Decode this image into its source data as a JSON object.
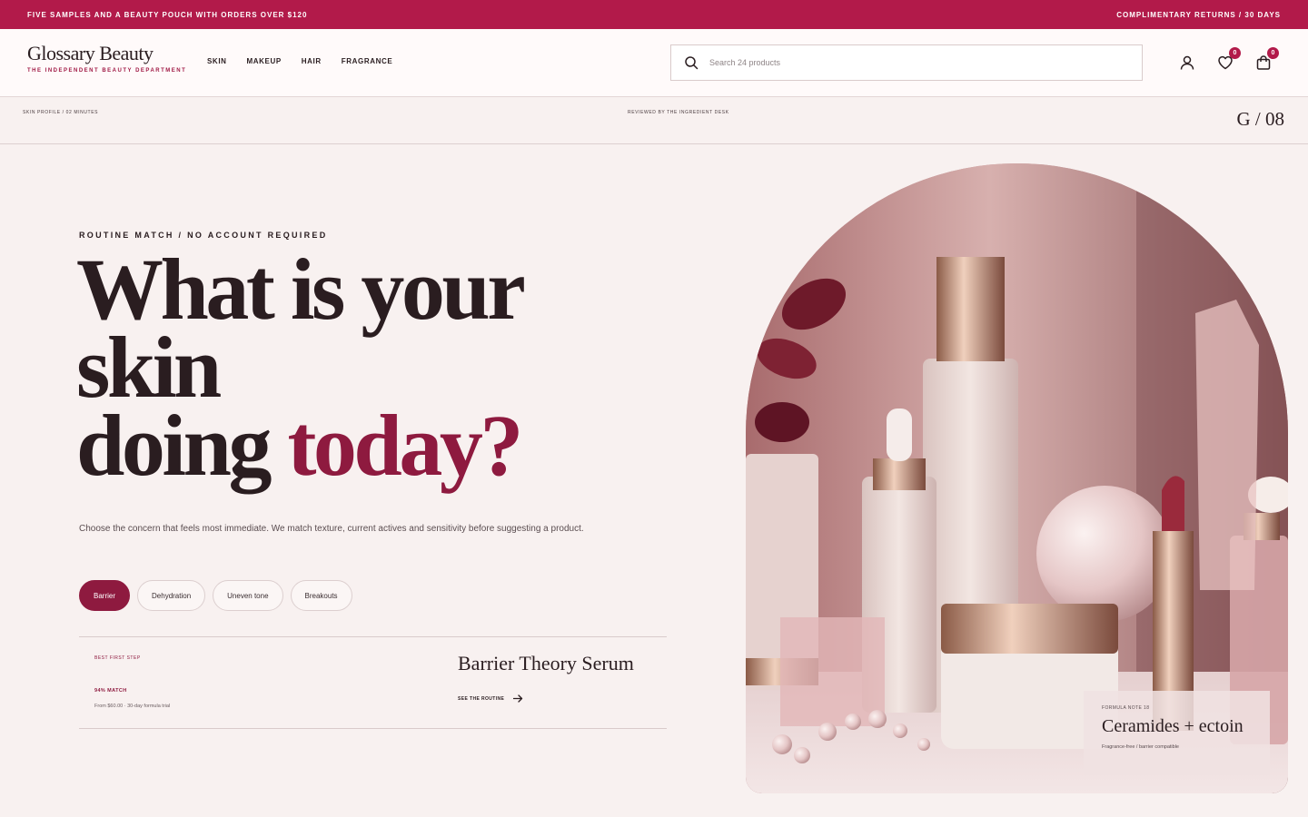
{
  "promo": {
    "left": "FIVE SAMPLES AND A BEAUTY POUCH WITH ORDERS OVER $120",
    "right": "COMPLIMENTARY RETURNS / 30 DAYS"
  },
  "brand": {
    "name": "Glossary Beauty",
    "tagline": "THE INDEPENDENT BEAUTY DEPARTMENT"
  },
  "nav": {
    "items": [
      {
        "label": "SKIN"
      },
      {
        "label": "MAKEUP"
      },
      {
        "label": "HAIR"
      },
      {
        "label": "FRAGRANCE"
      }
    ]
  },
  "search": {
    "placeholder": "Search 24 products",
    "value": ""
  },
  "header_icons": {
    "wishlist_count": "0",
    "bag_count": "0"
  },
  "subbar": {
    "left": "SKIN PROFILE / 02 MINUTES",
    "center": "REVIEWED BY THE INGREDIENT DESK",
    "right": "G / 08"
  },
  "hero": {
    "eyebrow": "ROUTINE MATCH / NO ACCOUNT REQUIRED",
    "headline_line1": "What is your",
    "headline_line2": "skin",
    "headline_line3_a": "doing ",
    "headline_line3_b": "today?",
    "description": "Choose the concern that feels most immediate. We match texture, current actives and sensitivity before suggesting a product.",
    "chips": [
      {
        "label": "Barrier",
        "active": true
      },
      {
        "label": "Dehydration",
        "active": false
      },
      {
        "label": "Uneven tone",
        "active": false
      },
      {
        "label": "Breakouts",
        "active": false
      }
    ]
  },
  "match": {
    "step": "BEST FIRST STEP",
    "percent": "94% MATCH",
    "price": "From $60.00 · 30-day formula trial",
    "product": "Barrier Theory Serum",
    "link": "SEE THE ROUTINE"
  },
  "note": {
    "label": "FORMULA NOTE 18",
    "title": "Ceramides + ectoin",
    "sub": "Fragrance-free / barrier compatible"
  },
  "colors": {
    "accent": "#b21a4a",
    "deep_accent": "#8e1a3f",
    "background": "#f8f1f0"
  }
}
